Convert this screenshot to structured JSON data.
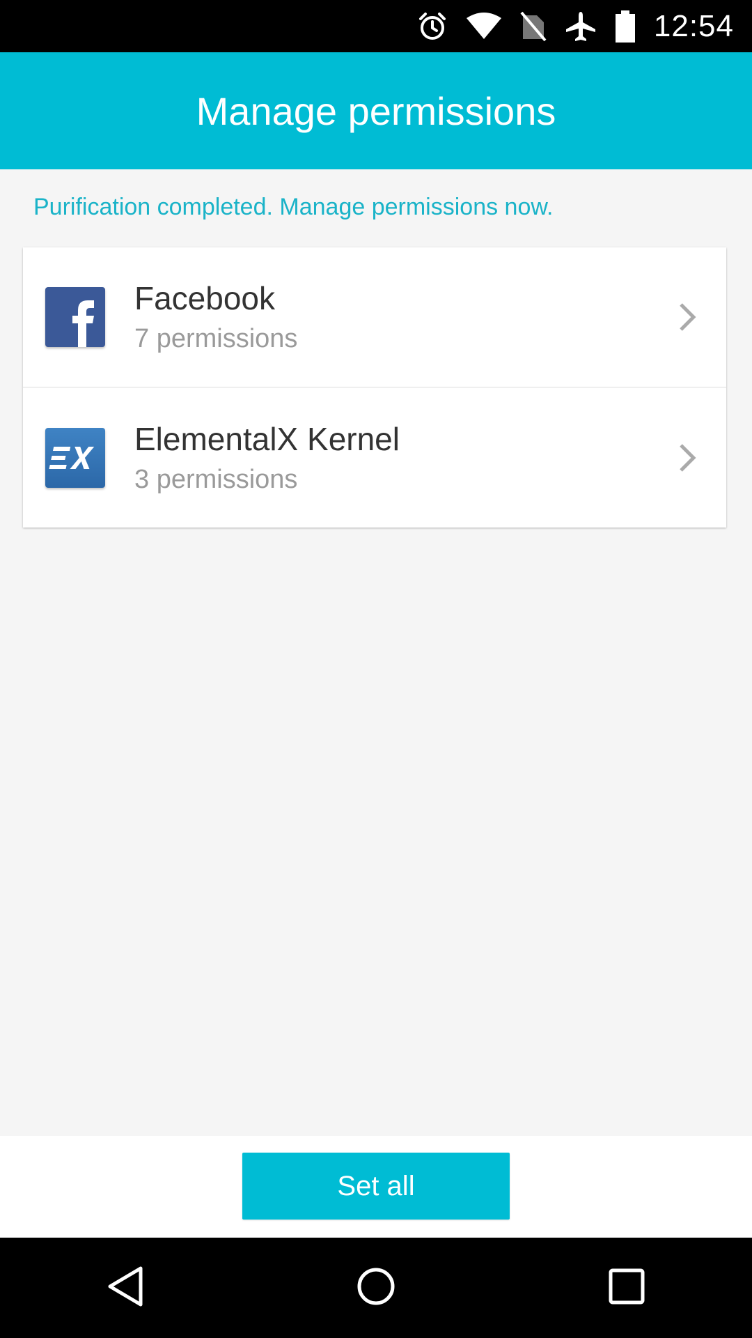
{
  "status_bar": {
    "time": "12:54",
    "icons": [
      "alarm-icon",
      "wifi-icon",
      "no-sim-icon",
      "airplane-mode-icon",
      "battery-icon"
    ]
  },
  "app_bar": {
    "title": "Manage permissions"
  },
  "notice": {
    "text": "Purification completed. Manage permissions now."
  },
  "apps": [
    {
      "name": "Facebook",
      "permissions": "7 permissions",
      "icon": "facebook-icon",
      "color": "#3b5998"
    },
    {
      "name": "ElementalX Kernel",
      "permissions": "3 permissions",
      "icon": "elementalx-icon",
      "color": "#2f6fb0"
    }
  ],
  "actions": {
    "set_all_label": "Set all"
  },
  "nav_bar": {
    "icons": [
      "back-icon",
      "home-icon",
      "recents-icon"
    ]
  },
  "colors": {
    "accent": "#00bcd4",
    "notice_text": "#1ab3c8",
    "background": "#f5f5f5"
  }
}
